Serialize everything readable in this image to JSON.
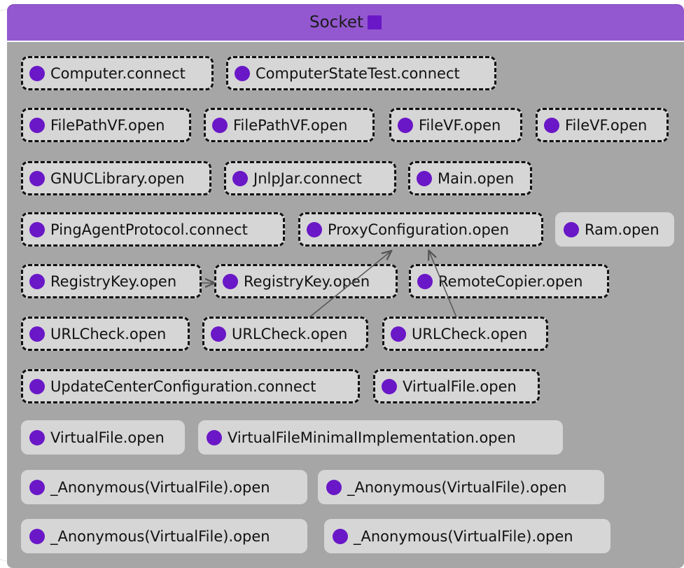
{
  "header": {
    "title": "Socket"
  },
  "colors": {
    "header": "#9358cf",
    "panel": "#a6a6a6",
    "node": "#d6d6d6",
    "dot": "#6a17c7"
  },
  "nodes": [
    {
      "label": "Computer.connect",
      "dashed": true
    },
    {
      "label": "ComputerStateTest.connect",
      "dashed": true
    },
    {
      "label": "FilePathVF.open",
      "dashed": true
    },
    {
      "label": "FilePathVF.open",
      "dashed": true
    },
    {
      "label": "FileVF.open",
      "dashed": true
    },
    {
      "label": "FileVF.open",
      "dashed": true
    },
    {
      "label": "GNUCLibrary.open",
      "dashed": true
    },
    {
      "label": "JnlpJar.connect",
      "dashed": true
    },
    {
      "label": "Main.open",
      "dashed": true
    },
    {
      "label": "PingAgentProtocol.connect",
      "dashed": true
    },
    {
      "label": "ProxyConfiguration.open",
      "dashed": true
    },
    {
      "label": "Ram.open",
      "dashed": false
    },
    {
      "label": "RegistryKey.open",
      "dashed": true
    },
    {
      "label": "RegistryKey.open",
      "dashed": true
    },
    {
      "label": "RemoteCopier.open",
      "dashed": true
    },
    {
      "label": "URLCheck.open",
      "dashed": true
    },
    {
      "label": "URLCheck.open",
      "dashed": true
    },
    {
      "label": "URLCheck.open",
      "dashed": true
    },
    {
      "label": "UpdateCenterConfiguration.connect",
      "dashed": true
    },
    {
      "label": "VirtualFile.open",
      "dashed": true
    },
    {
      "label": "VirtualFile.open",
      "dashed": false
    },
    {
      "label": "VirtualFileMinimalImplementation.open",
      "dashed": false
    },
    {
      "label": "_Anonymous(VirtualFile).open",
      "dashed": false
    },
    {
      "label": "_Anonymous(VirtualFile).open",
      "dashed": false
    },
    {
      "label": "_Anonymous(VirtualFile).open",
      "dashed": false
    },
    {
      "label": "_Anonymous(VirtualFile).open",
      "dashed": false
    }
  ],
  "edges": [
    {
      "from": 12,
      "to": 13
    },
    {
      "from": 16,
      "to": 10
    },
    {
      "from": 17,
      "to": 10
    }
  ]
}
